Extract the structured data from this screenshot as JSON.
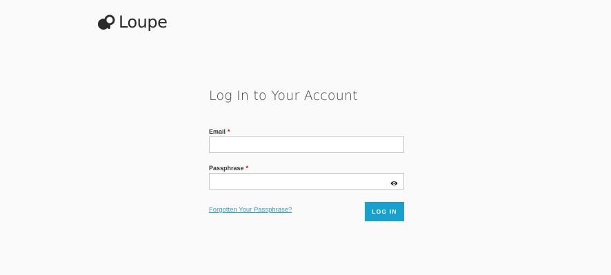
{
  "brand": {
    "name": "Loupe",
    "logo_icon": "loupe-logo-icon"
  },
  "form": {
    "title": "Log In to Your Account",
    "email_label": "Email",
    "email_value": "",
    "passphrase_label": "Passphrase",
    "passphrase_value": "",
    "required_marker": "*",
    "show_password_icon": "eye-icon",
    "forgot_link": "Forgotten Your Passphrase?",
    "submit_label": "LOG IN"
  },
  "colors": {
    "accent": "#18a0cf",
    "link": "#2a9fc8",
    "required": "#d0021b",
    "background": "#fafafa"
  }
}
